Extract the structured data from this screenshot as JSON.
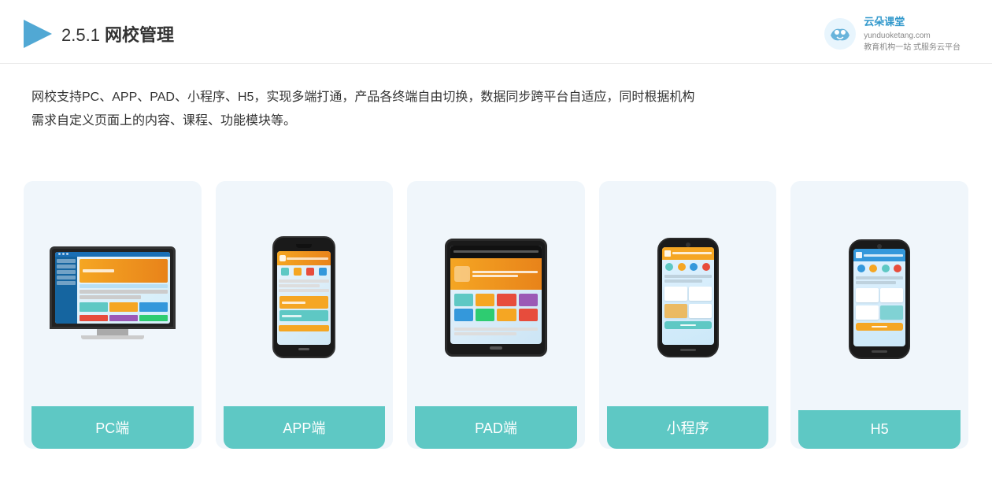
{
  "header": {
    "section_number": "2.5.1",
    "title_normal": "2.5.1 ",
    "title_bold": "网校管理",
    "brand_name": "云朵课堂",
    "brand_url": "yunduoketang.com",
    "brand_tagline": "教育机构一站\n式服务云平台"
  },
  "description": {
    "text_line1": "网校支持PC、APP、PAD、小程序、H5，实现多端打通，产品各终端自由切换，数据同步跨平台自适应，同时根据机构",
    "text_line2": "需求自定义页面上的内容、课程、功能模块等。"
  },
  "cards": [
    {
      "id": "pc",
      "label": "PC端"
    },
    {
      "id": "app",
      "label": "APP端"
    },
    {
      "id": "pad",
      "label": "PAD端"
    },
    {
      "id": "miniprogram",
      "label": "小程序"
    },
    {
      "id": "h5",
      "label": "H5"
    }
  ]
}
